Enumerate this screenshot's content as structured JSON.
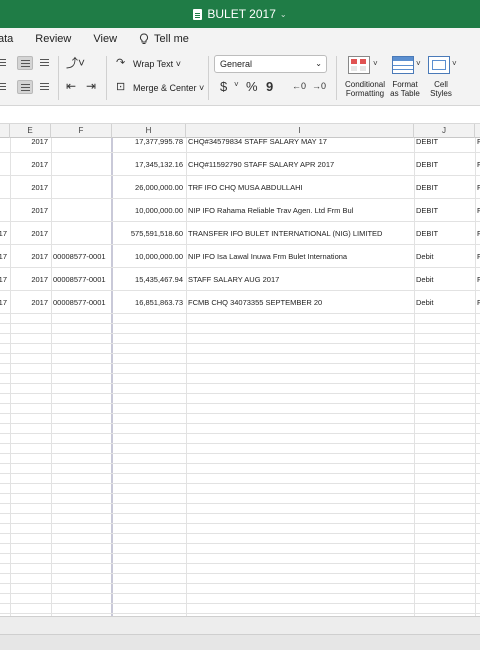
{
  "window": {
    "title": "BULET 2017"
  },
  "ribbon_tabs": [
    "ata",
    "Review",
    "View"
  ],
  "tell_me": "Tell me",
  "ribbon": {
    "wrap_text": "Wrap Text",
    "merge_center": "Merge & Center",
    "number_format": "General",
    "currency_symbol": "$",
    "percent_symbol": "%",
    "comma_symbol": "9",
    "conditional_formatting": [
      "Conditional",
      "Formatting"
    ],
    "format_as_table": [
      "Format",
      "as Table"
    ],
    "cell_styles": [
      "Cell",
      "Styles"
    ]
  },
  "columns": [
    "E",
    "F",
    "H",
    "I",
    "J"
  ],
  "rows": [
    {
      "d": "",
      "e": "2017",
      "f": "",
      "h": "17,377,995.78",
      "i": "CHQ#34579834 STAFF SALARY MAY 17",
      "j": "DEBIT",
      "k": "F"
    },
    {
      "d": "",
      "e": "2017",
      "f": "",
      "h": "17,345,132.16",
      "i": "CHQ#11592790 STAFF SALARY APR 2017",
      "j": "DEBIT",
      "k": "F"
    },
    {
      "d": "",
      "e": "2017",
      "f": "",
      "h": "26,000,000.00",
      "i": "TRF IFO CHQ MUSA ABDULLAHI",
      "j": "DEBIT",
      "k": "F"
    },
    {
      "d": "",
      "e": "2017",
      "f": "",
      "h": "10,000,000.00",
      "i": "NIP IFO Rahama Reliable Trav Agen. Ltd Frm Bul",
      "j": "DEBIT",
      "k": "F"
    },
    {
      "d": "17",
      "e": "2017",
      "f": "",
      "h": "575,591,518.60",
      "i": "TRANSFER IFO BULET INTERNATIONAL (NIG) LIMITED",
      "j": "DEBIT",
      "k": "F"
    },
    {
      "d": "17",
      "e": "2017",
      "f": "00008577-0001",
      "h": "10,000,000.00",
      "i": "NIP IFO Isa Lawal Inuwa Frm Bulet Internationa",
      "j": "Debit",
      "k": "F"
    },
    {
      "d": "17",
      "e": "2017",
      "f": "00008577-0001",
      "h": "15,435,467.94",
      "i": "STAFF SALARY AUG 2017",
      "j": "Debit",
      "k": "F"
    },
    {
      "d": "17",
      "e": "2017",
      "f": "00008577-0001",
      "h": "16,851,863.73",
      "i": "FCMB CHQ 34073355 SEPTEMBER 20",
      "j": "Debit",
      "k": "F"
    }
  ]
}
